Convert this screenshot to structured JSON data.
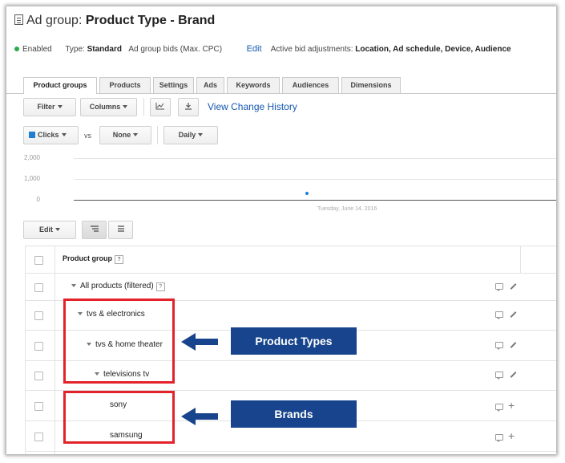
{
  "header": {
    "prefix": "Ad group: ",
    "name": "Product Type - Brand"
  },
  "status": {
    "state": "Enabled",
    "type_label": "Type:",
    "type_value": "Standard",
    "bids_label": "Ad group bids (Max. CPC)",
    "edit_link": "Edit",
    "adjust_label": "Active bid adjustments:",
    "adjust_value": "Location, Ad schedule, Device, Audience"
  },
  "tabs": [
    "Product groups",
    "Products",
    "Settings",
    "Ads",
    "Keywords",
    "Audiences",
    "Dimensions"
  ],
  "toolbar": {
    "filter": "Filter",
    "columns": "Columns",
    "history_link": "View Change History",
    "metric1": "Clicks",
    "vs": "vs",
    "metric2": "None",
    "interval": "Daily"
  },
  "chart_data": {
    "type": "scatter",
    "y_ticks": [
      "2,000",
      "1,000",
      "0"
    ],
    "ylim": [
      0,
      2000
    ],
    "x_label": "Tuesday, June 14, 2016",
    "series": [
      {
        "values": [
          320
        ]
      }
    ],
    "color": "#1f7fd1"
  },
  "table": {
    "edit_label": "Edit",
    "header": "Product group",
    "header_help": "?",
    "rows": [
      {
        "label": "All products (filtered)",
        "help": "?",
        "action": "pencil"
      },
      {
        "label": "tvs & electronics",
        "action": "pencil"
      },
      {
        "label": "tvs & home theater",
        "action": "pencil"
      },
      {
        "label": "televisions tv",
        "action": "pencil"
      },
      {
        "label": "sony",
        "action": "plus"
      },
      {
        "label": "samsung",
        "action": "plus"
      }
    ]
  },
  "annotations": {
    "product_types": "Product Types",
    "brands": "Brands",
    "box_color": "#e3222a",
    "label_color": "#17448c"
  },
  "icons": [
    "ad-group-icon",
    "chart-toggle-icon",
    "download-icon",
    "tree-view-icon",
    "list-view-icon",
    "comment-icon",
    "pencil-icon",
    "plus-icon"
  ]
}
